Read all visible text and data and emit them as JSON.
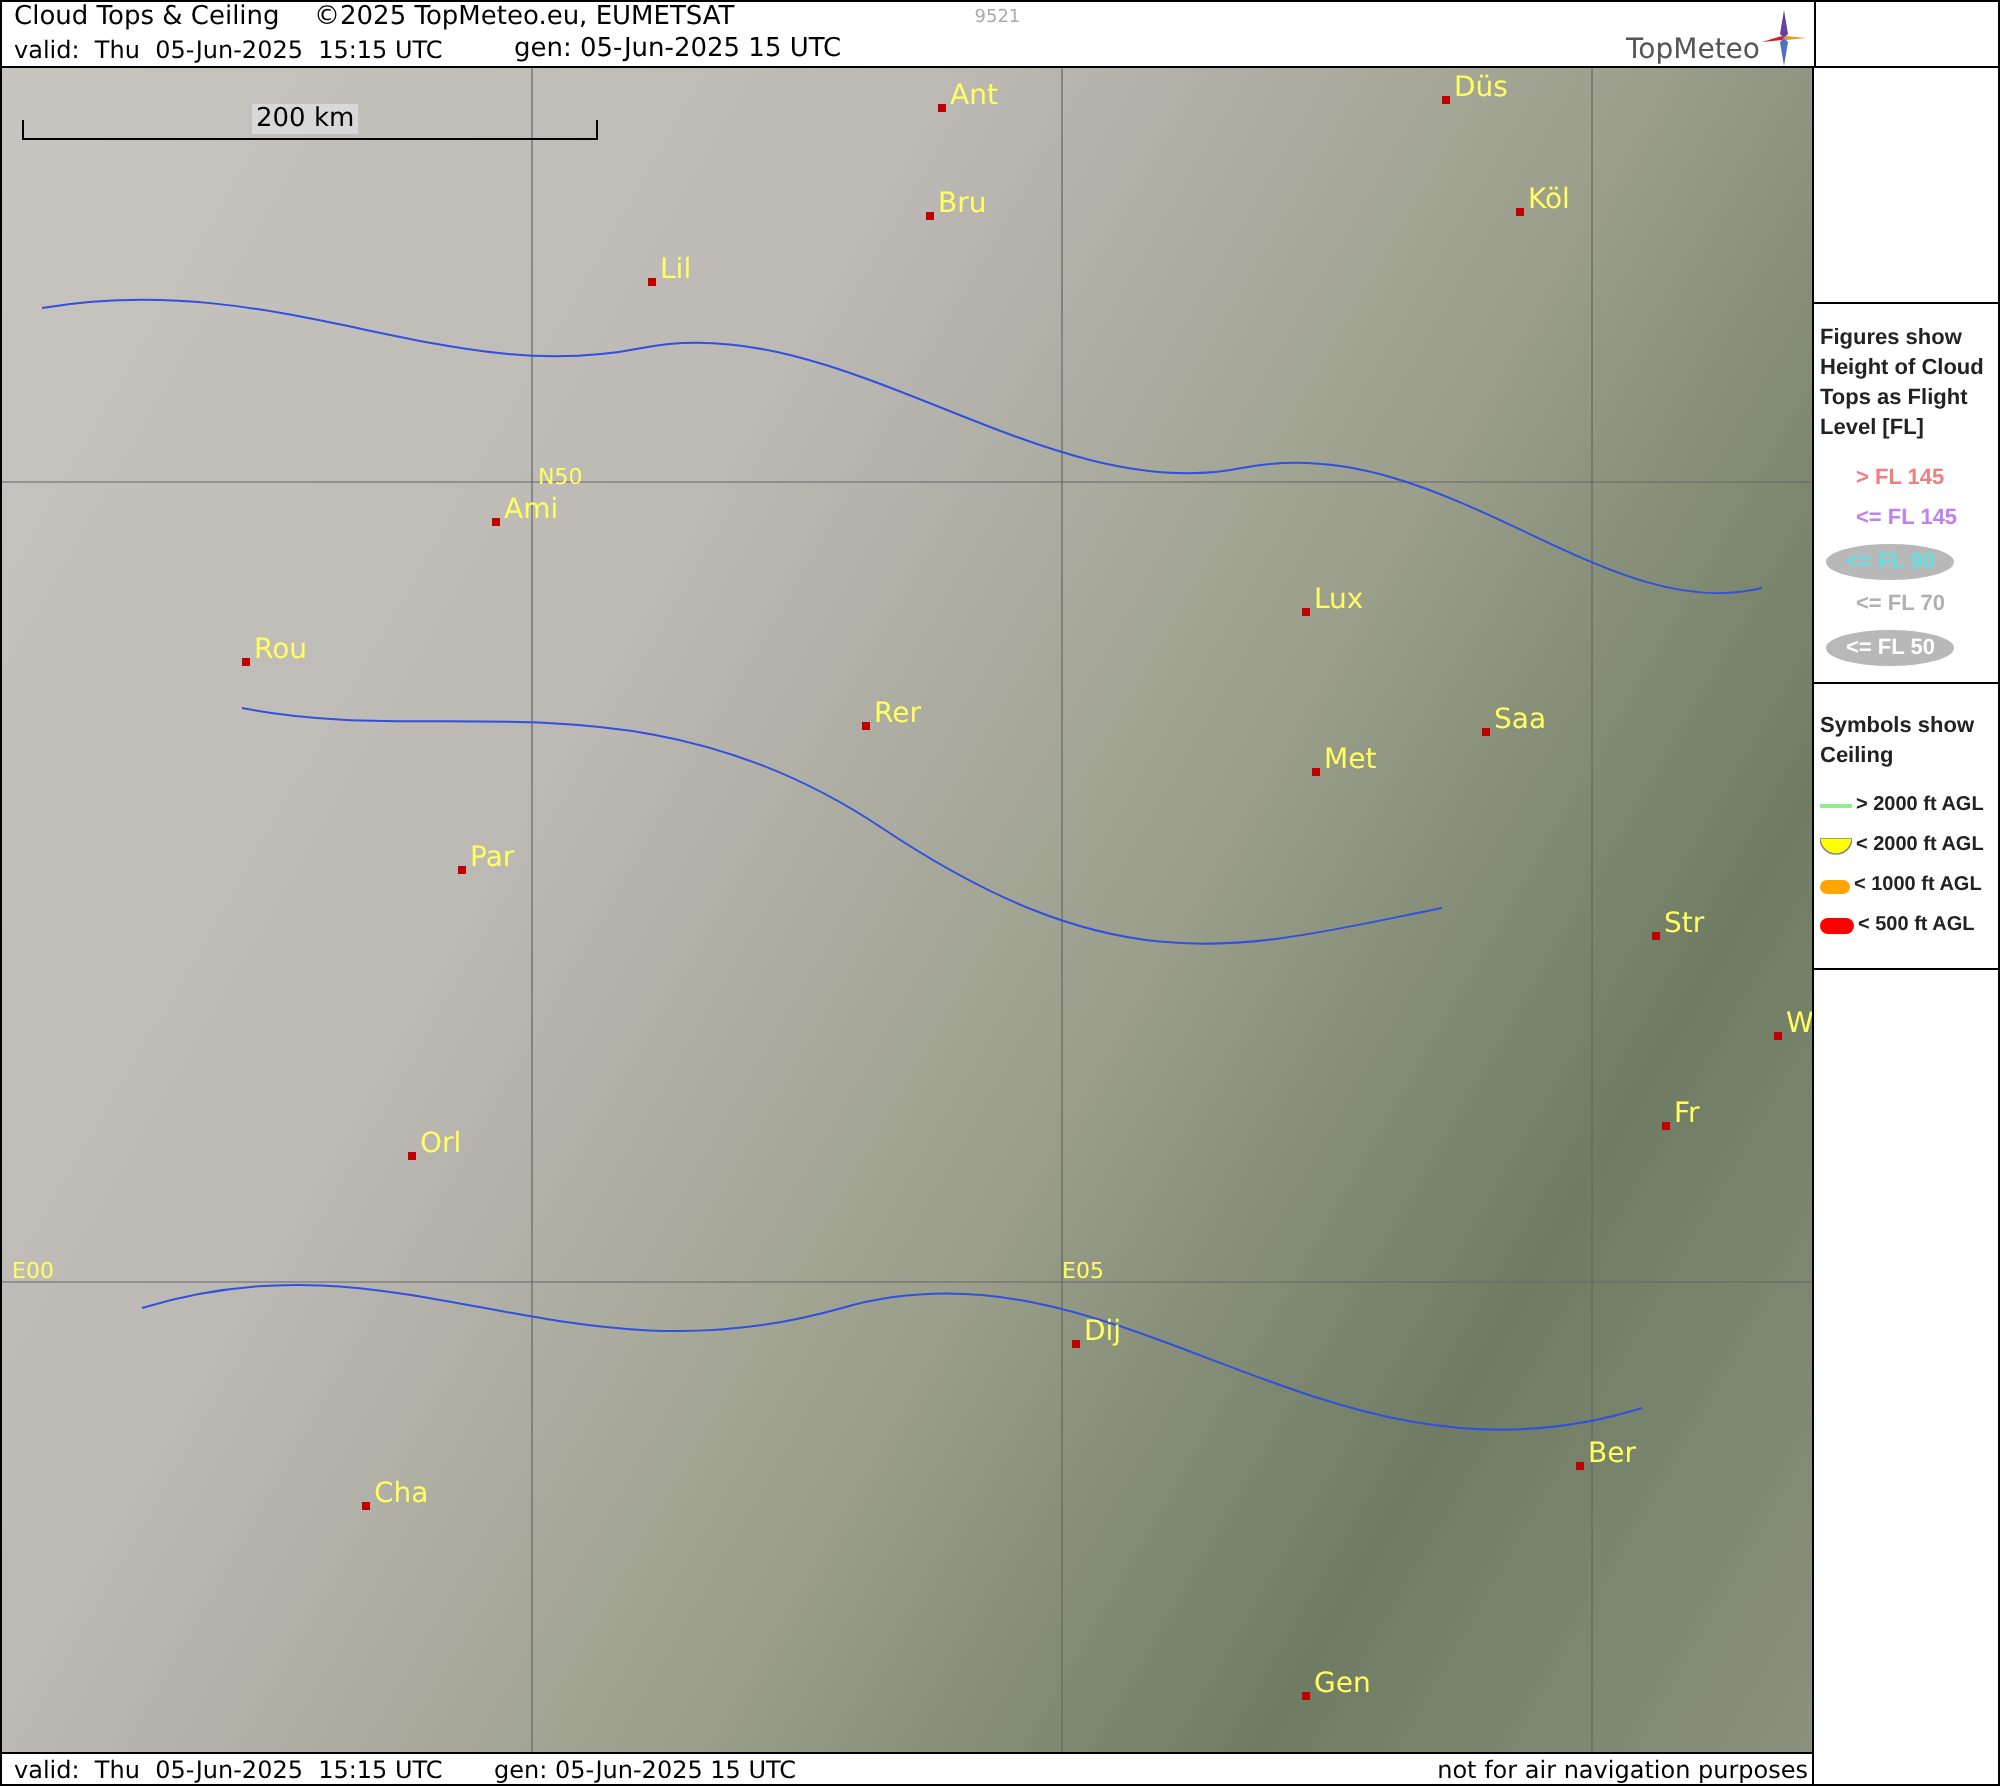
{
  "header": {
    "title": "Cloud Tops & Ceiling",
    "copyright": "©2025 TopMeteo.eu, EUMETSAT",
    "code": "9521",
    "valid": "valid:  Thu  05-Jun-2025  15:15 UTC",
    "generated": "gen: 05-Jun-2025 15 UTC",
    "logo": "TopMeteo"
  },
  "map": {
    "scale": "200 km",
    "labels": [
      {
        "text": "Ant",
        "kind": "city"
      },
      {
        "text": "Düs",
        "kind": "city"
      },
      {
        "text": "Bru",
        "kind": "city"
      },
      {
        "text": "Köl",
        "kind": "city"
      },
      {
        "text": "Lil",
        "kind": "city"
      },
      {
        "text": "N50",
        "kind": "grid"
      },
      {
        "text": "Ami",
        "kind": "city"
      },
      {
        "text": "Rou",
        "kind": "city"
      },
      {
        "text": "Lux",
        "kind": "city"
      },
      {
        "text": "Rer",
        "kind": "city"
      },
      {
        "text": "Saa",
        "kind": "city"
      },
      {
        "text": "Met",
        "kind": "city"
      },
      {
        "text": "Par",
        "kind": "city"
      },
      {
        "text": "Str",
        "kind": "city"
      },
      {
        "text": "W",
        "kind": "city"
      },
      {
        "text": "Fr",
        "kind": "city"
      },
      {
        "text": "Orl",
        "kind": "city"
      },
      {
        "text": "E00",
        "kind": "grid"
      },
      {
        "text": "E05",
        "kind": "grid"
      },
      {
        "text": "Dij",
        "kind": "city"
      },
      {
        "text": "Ber",
        "kind": "city"
      },
      {
        "text": "Cha",
        "kind": "city"
      },
      {
        "text": "Gen",
        "kind": "city"
      }
    ]
  },
  "legend": {
    "tops_title": "Figures show Height of Cloud Tops as Flight Level  [FL]",
    "tops": [
      {
        "label": "> FL 145",
        "color": "#f08080",
        "kind": "plain"
      },
      {
        "label": "<= FL 145",
        "color": "#c080f0",
        "kind": "plain"
      },
      {
        "label": "<= FL 90",
        "color": "#60e0e0",
        "kind": "oval"
      },
      {
        "label": "<= FL 70",
        "color": "#b0b0b0",
        "kind": "plain"
      },
      {
        "label": "<= FL 50",
        "color": "#ffffff",
        "kind": "oval"
      }
    ],
    "ceiling_title": "Symbols show Ceiling",
    "ceiling": [
      {
        "label": "> 2000 ft AGL",
        "kind": "line"
      },
      {
        "label": "< 2000 ft AGL",
        "kind": "half"
      },
      {
        "label": "< 1000 ft AGL",
        "kind": "orange"
      },
      {
        "label": "< 500 ft AGL",
        "kind": "red"
      }
    ]
  },
  "footer": {
    "valid": "valid:  Thu  05-Jun-2025  15:15 UTC",
    "generated": "gen: 05-Jun-2025 15 UTC",
    "note": "not for air navigation purposes"
  }
}
